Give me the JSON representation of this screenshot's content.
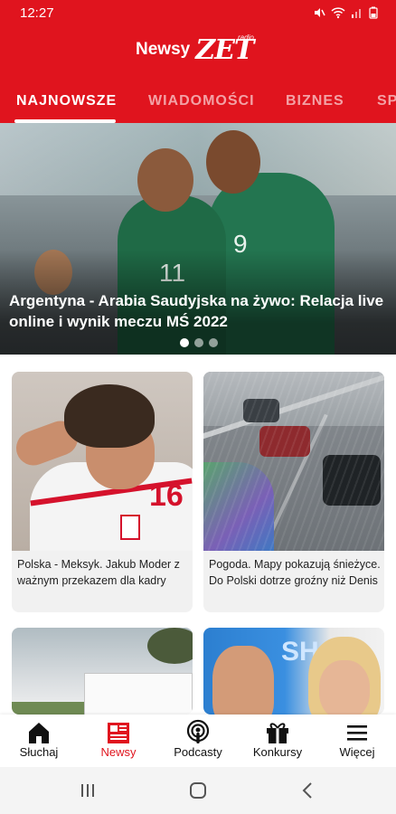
{
  "status_bar": {
    "time": "12:27"
  },
  "header": {
    "logo_newsy": "Newsy",
    "logo_zet": "ZET",
    "logo_radio": "radio"
  },
  "tabs": [
    {
      "label": "NAJNOWSZE",
      "active": true
    },
    {
      "label": "WIADOMOŚCI",
      "active": false
    },
    {
      "label": "BIZNES",
      "active": false
    },
    {
      "label": "SP",
      "active": false
    }
  ],
  "hero": {
    "title": "Argentyna - Arabia Saudyjska na żywo: Relacja live online i wynik meczu MŚ 2022",
    "jersey_numbers": [
      "11",
      "9"
    ],
    "dots_total": 3,
    "dots_active": 1
  },
  "cards": [
    {
      "caption": "Polska - Meksyk. Jakub Moder z ważnym przekazem dla kadry",
      "image": "football-player",
      "jersey_number": "16"
    },
    {
      "caption": "Pogoda. Mapy pokazują śnieżyce. Do Polski dotrze groźny niż Denis",
      "image": "snowy-road"
    },
    {
      "caption": "",
      "image": "document-outdoor"
    },
    {
      "caption": "",
      "image": "two-people",
      "sign_text": "SH"
    }
  ],
  "bottom_nav": [
    {
      "label": "Słuchaj",
      "icon": "home-icon",
      "active": false
    },
    {
      "label": "Newsy",
      "icon": "newspaper-icon",
      "active": true
    },
    {
      "label": "Podcasty",
      "icon": "podcast-icon",
      "active": false
    },
    {
      "label": "Konkursy",
      "icon": "gift-icon",
      "active": false
    },
    {
      "label": "Więcej",
      "icon": "menu-icon",
      "active": false
    }
  ],
  "colors": {
    "brand_red": "#e0141e",
    "inactive_tab": "rgba(255,255,255,0.6)",
    "card_bg": "#f1f1f1"
  }
}
